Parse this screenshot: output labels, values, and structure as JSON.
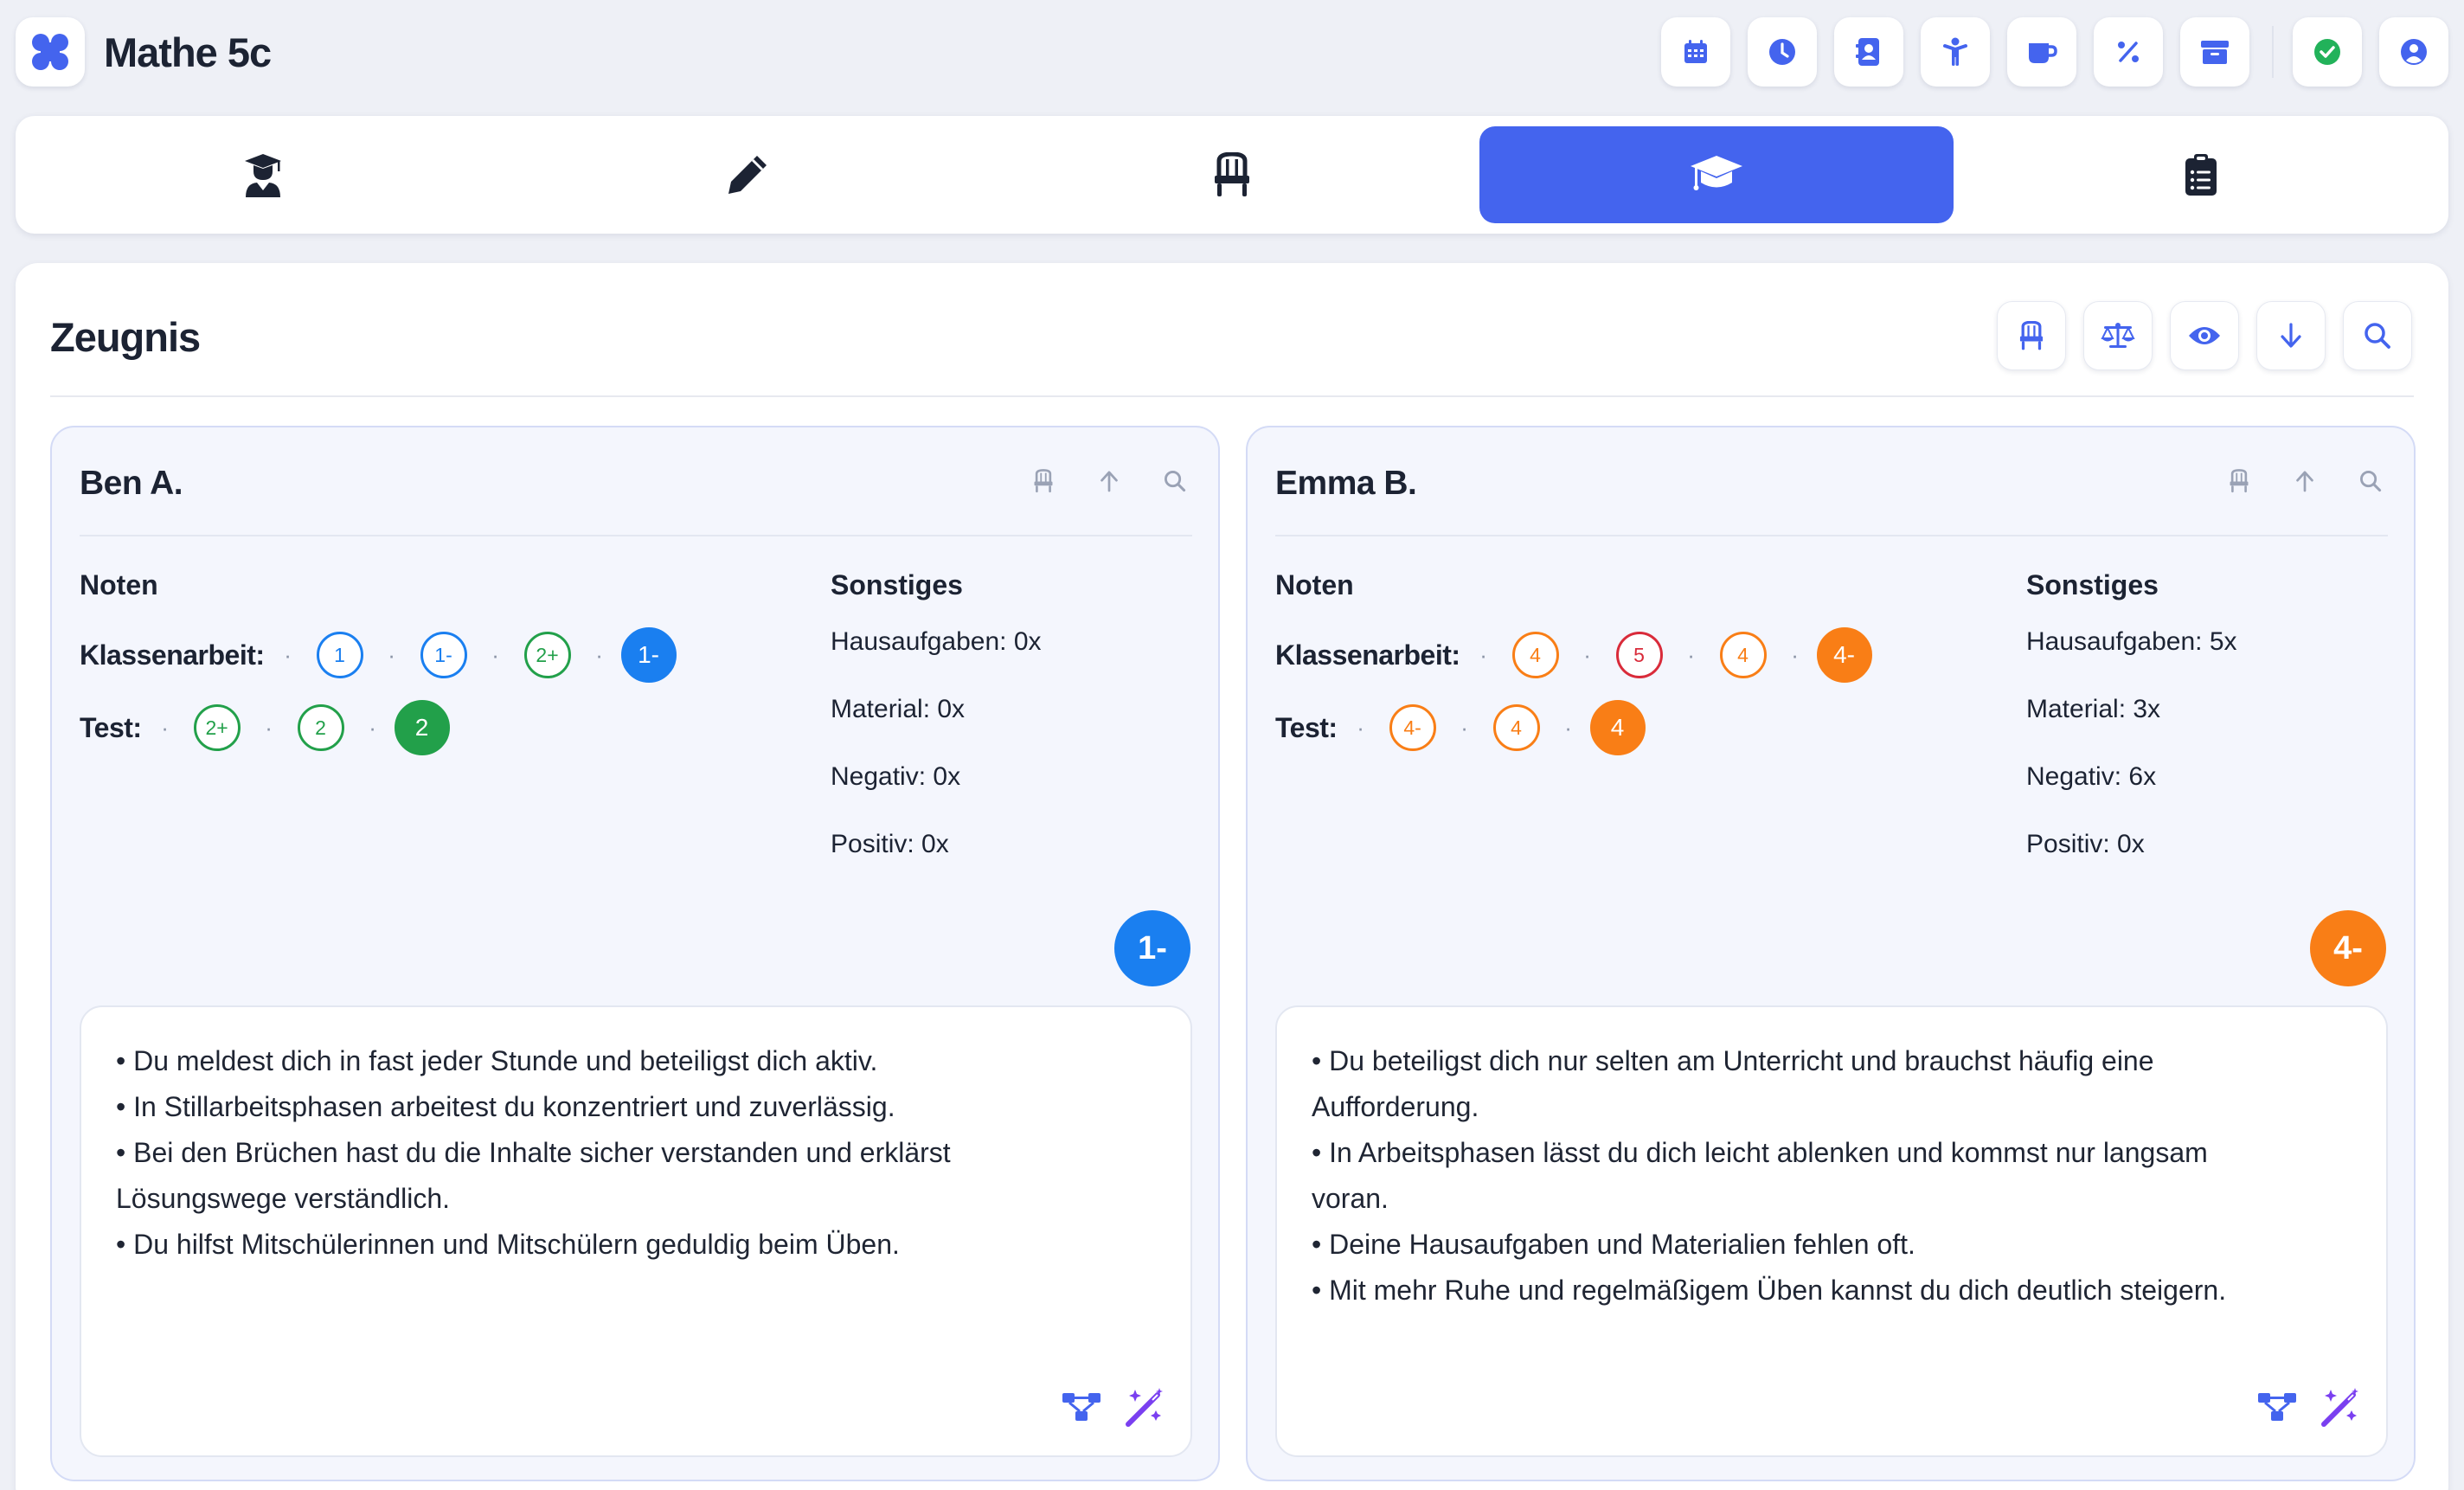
{
  "app": {
    "title": "Mathe 5c"
  },
  "toolbar": {
    "buttons": [
      {
        "icon": "calendar-icon"
      },
      {
        "icon": "clock-icon"
      },
      {
        "icon": "contact-book-icon"
      },
      {
        "icon": "person-icon"
      },
      {
        "icon": "coffee-icon"
      },
      {
        "icon": "percent-icon"
      },
      {
        "icon": "archive-icon"
      },
      {
        "icon": "check-circle-icon",
        "color": "#22b25a"
      },
      {
        "icon": "user-circle-icon"
      }
    ]
  },
  "tabs": [
    {
      "icon": "student-icon",
      "active": false
    },
    {
      "icon": "pencil-icon",
      "active": false
    },
    {
      "icon": "chair-icon",
      "active": false
    },
    {
      "icon": "graduation-cap-icon",
      "active": true
    },
    {
      "icon": "clipboard-icon",
      "active": false
    }
  ],
  "page": {
    "title": "Zeugnis",
    "actions": [
      "chair-icon",
      "scale-icon",
      "eye-icon",
      "arrow-down-icon",
      "search-icon"
    ]
  },
  "colors": {
    "accent": "#4464ee",
    "blue": "#1a7ff0",
    "green": "#22a04a",
    "orange": "#f97e16",
    "red": "#d92b3a",
    "purple": "#7a3ff0"
  },
  "students": [
    {
      "name": "Ben A.",
      "noten_label": "Noten",
      "sonstiges_label": "Sonstiges",
      "klassenarbeit_label": "Klassenarbeit:",
      "test_label": "Test:",
      "klassenarbeit": [
        {
          "grade": "1",
          "color": "#1a7ff0"
        },
        {
          "grade": "1-",
          "color": "#1a7ff0"
        },
        {
          "grade": "2+",
          "color": "#22a04a"
        }
      ],
      "klassenarbeit_avg": {
        "grade": "1-",
        "color": "#1a7ff0"
      },
      "test": [
        {
          "grade": "2+",
          "color": "#22a04a"
        },
        {
          "grade": "2",
          "color": "#22a04a"
        }
      ],
      "test_avg": {
        "grade": "2",
        "color": "#22a04a"
      },
      "misc": {
        "hausaufgaben": "Hausaufgaben: 0x",
        "material": "Material: 0x",
        "negativ": "Negativ: 0x",
        "positiv": "Positiv: 0x"
      },
      "final_grade": {
        "grade": "1-",
        "color": "#1a7ff0"
      },
      "comment": "• Du meldest dich in fast jeder Stunde und beteiligst dich aktiv.\n• In Stillarbeitsphasen arbeitest du konzentriert und zuverlässig.\n• Bei den Brüchen hast du die Inhalte sicher verstanden und erklärst\nLösungswege verständlich.\n• Du hilfst Mitschülerinnen und Mitschülern geduldig beim Üben."
    },
    {
      "name": "Emma B.",
      "noten_label": "Noten",
      "sonstiges_label": "Sonstiges",
      "klassenarbeit_label": "Klassenarbeit:",
      "test_label": "Test:",
      "klassenarbeit": [
        {
          "grade": "4",
          "color": "#f97e16"
        },
        {
          "grade": "5",
          "color": "#d92b3a"
        },
        {
          "grade": "4",
          "color": "#f97e16"
        }
      ],
      "klassenarbeit_avg": {
        "grade": "4-",
        "color": "#f97e16"
      },
      "test": [
        {
          "grade": "4-",
          "color": "#f97e16"
        },
        {
          "grade": "4",
          "color": "#f97e16"
        }
      ],
      "test_avg": {
        "grade": "4",
        "color": "#f97e16"
      },
      "misc": {
        "hausaufgaben": "Hausaufgaben: 5x",
        "material": "Material: 3x",
        "negativ": "Negativ: 6x",
        "positiv": "Positiv: 0x"
      },
      "final_grade": {
        "grade": "4-",
        "color": "#f97e16"
      },
      "comment": "• Du beteiligst dich nur selten am Unterricht und brauchst häufig eine\nAufforderung.\n• In Arbeitsphasen lässt du dich leicht ablenken und kommst nur langsam\nvoran.\n• Deine Hausaufgaben und Materialien fehlen oft.\n• Mit mehr Ruhe und regelmäßigem Üben kannst du dich deutlich steigern."
    }
  ]
}
